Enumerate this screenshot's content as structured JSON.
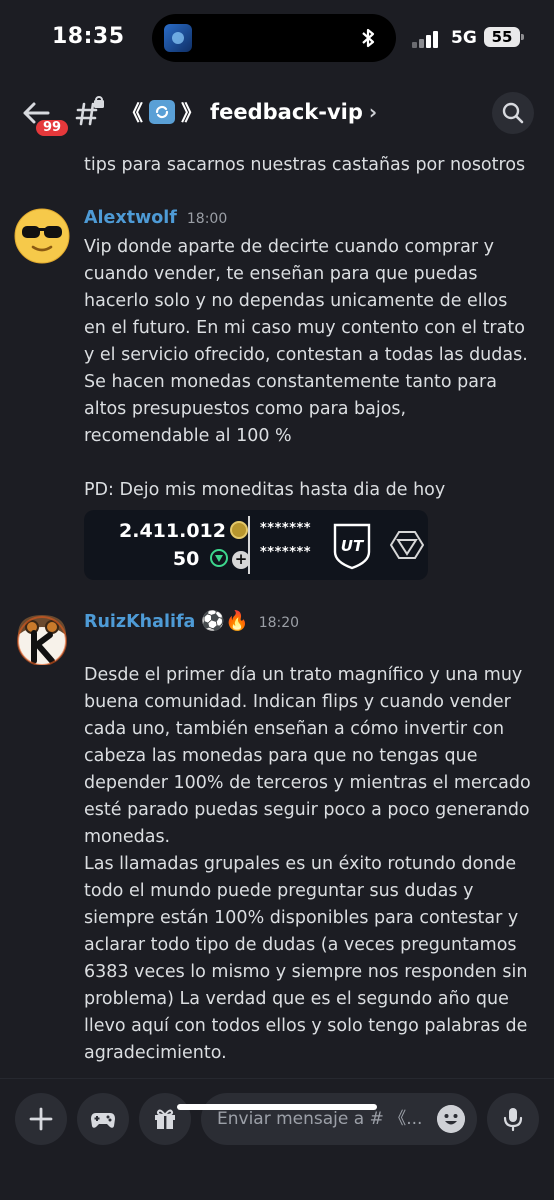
{
  "status_bar": {
    "time": "18:35",
    "network": "5G",
    "battery": "55"
  },
  "header": {
    "badge_count": "99",
    "channel_prefix": "《",
    "channel_suffix": "》",
    "channel_name": "feedback-vip",
    "chevron": "›"
  },
  "messages": {
    "cut_text": "tips para sacarnos nuestras castañas por nosotros",
    "items": [
      {
        "author": "Alextwolf",
        "time": "18:00",
        "avatar_icon": "sunglasses-emoji-avatar",
        "paragraphs": [
          "Vip donde aparte de decirte cuando comprar y cuando vender, te enseñan  para que puedas hacerlo solo y no dependas unicamente de ellos en el futuro. En mi caso muy contento con el trato y el servicio ofrecido, contestan a todas las dudas. Se hacen monedas constantemente tanto para altos presupuestos como para bajos, recomendable al 100 %",
          "PD: Dejo mis moneditas hasta dia de hoy"
        ],
        "embed": {
          "coins": "2.411.012",
          "points": "50",
          "masked_1": "*******",
          "masked_2": "*******",
          "badge_text": "UT"
        }
      },
      {
        "author": "RuizKhalifa",
        "author_emojis": "⚽🔥",
        "time": "18:20",
        "avatar_icon": "k-logo-avatar",
        "paragraphs": [
          "Desde el primer día un trato magnífico y una muy buena comunidad. Indican flips y cuando vender cada uno, también enseñan a cómo invertir con cabeza las monedas para que no tengas que depender 100% de terceros y mientras el mercado esté parado puedas seguir poco a poco generando monedas.\nLas llamadas grupales es un éxito rotundo donde todo el mundo puede preguntar sus dudas y siempre están 100% disponibles para contestar y aclarar todo tipo de dudas (a veces preguntamos 6383 veces lo mismo y siempre nos responden sin problema) La verdad que es el segundo año que llevo aquí con todos ellos y solo tengo palabras de agradecimiento."
        ]
      }
    ]
  },
  "composer": {
    "placeholder": "Enviar mensaje a # 《..."
  },
  "colors": {
    "background": "#1c1d23",
    "author": "#4e9bd6",
    "badge": "#e5383b"
  }
}
